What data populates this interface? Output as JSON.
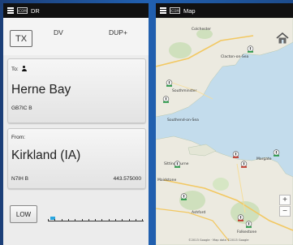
{
  "dr_screen": {
    "title": "DR",
    "tx_label": "TX",
    "mode_dv": "DV",
    "mode_dup": "DUP+",
    "to_card": {
      "label": "To:",
      "station_name": "Herne Bay",
      "callsign": "GB7IC B"
    },
    "from_card": {
      "label": "From:",
      "station_name": "Kirkland (IA)",
      "callsign": "N7IH  B",
      "frequency": "443.575000"
    },
    "power_label": "LOW",
    "signal_level": 0.05
  },
  "map_screen": {
    "title": "Map",
    "zoom_in": "+",
    "zoom_out": "−",
    "labels": {
      "colchester": "Colchester",
      "clacton": "Clacton-on-Sea",
      "southminster": "Southminster",
      "southend": "Southend-on-Sea",
      "sittingbourne": "Sittingbourne",
      "maidstone": "Maidstone",
      "ashford": "Ashford",
      "folkestone": "Folkestone",
      "margate": "Margate",
      "copyright": "©2013 Google · Map data ©2013 Google"
    }
  },
  "colors": {
    "background": "#1f4f8e",
    "status_bar": "#111111",
    "meter_fill": "#2aa6df",
    "sea": "#c3dcec",
    "land": "#eceae0"
  },
  "icons": [
    "menu-icon",
    "app-icon",
    "user-icon",
    "home-icon",
    "repeater-pin-icon"
  ]
}
